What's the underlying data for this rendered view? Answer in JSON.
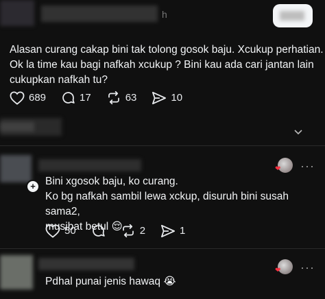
{
  "post1": {
    "time_fragment": "h",
    "text_lines": [
      "Alasan curang cakap bini tak tolong gosok baju.  Xcukup perhatian.",
      "Ok la time kau bagi nafkah xcukup ? Bini kau ada cari jantan lain",
      "cukupkan nafkah tu?"
    ],
    "likes": "689",
    "replies": "17",
    "reposts": "63",
    "shares": "10"
  },
  "reply1": {
    "text_lines": [
      "Bini xgosok baju, ko curang.",
      "Ko bg nafkah sambil lewa xckup, disuruh bini susah sama2,",
      "musibat betul 😌"
    ],
    "likes": "50",
    "reposts": "2",
    "shares": "1",
    "more": "···"
  },
  "reply2": {
    "text": "Pdhal punai jenis hawaq 😭",
    "more": "···"
  },
  "colors": {
    "background": "#101010",
    "text": "#f3f5f7",
    "heart": "#ff3040"
  },
  "icons": [
    "heart-icon",
    "comment-icon",
    "repost-icon",
    "share-icon",
    "plus-icon",
    "more-icon"
  ]
}
